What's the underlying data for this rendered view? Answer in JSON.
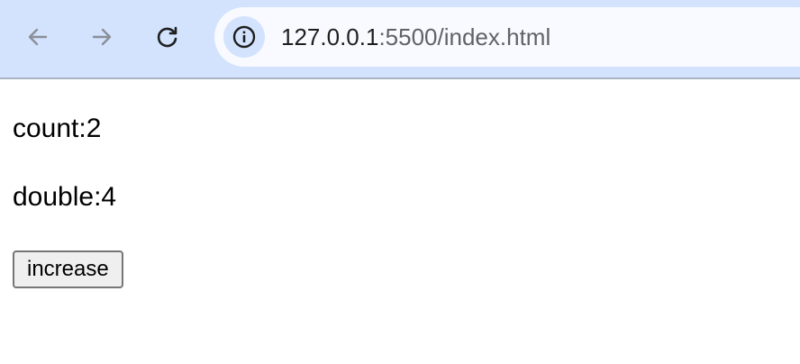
{
  "browser": {
    "url_host": "127.0.0.1",
    "url_rest": ":5500/index.html",
    "icons": {
      "back": "back-arrow-icon",
      "forward": "forward-arrow-icon",
      "reload": "reload-icon",
      "site_info": "info-icon"
    }
  },
  "page": {
    "count_label": "count:2",
    "double_label": "double:4",
    "increase_button": "increase"
  }
}
